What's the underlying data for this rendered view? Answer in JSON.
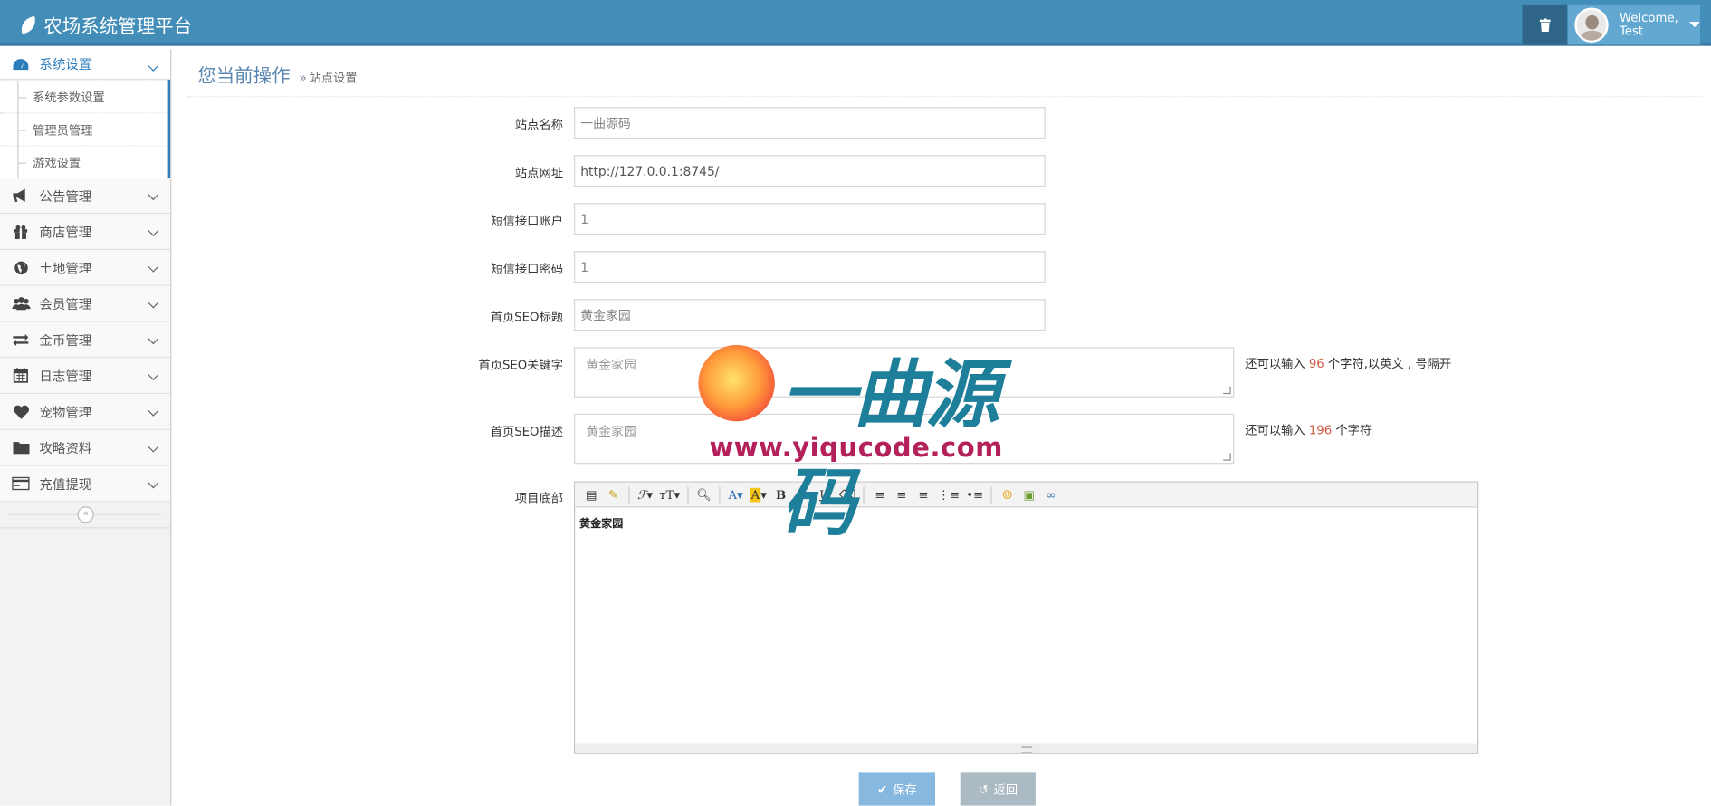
{
  "header": {
    "brand": "农场系统管理平台",
    "user_welcome": "Welcome,",
    "user_name": "Test"
  },
  "sidebar": {
    "items": [
      {
        "label": "系统设置",
        "icon": "dashboard-icon",
        "open": true,
        "children": [
          "系统参数设置",
          "管理员管理",
          "游戏设置"
        ]
      },
      {
        "label": "公告管理",
        "icon": "bullhorn-icon"
      },
      {
        "label": "商店管理",
        "icon": "gift-icon"
      },
      {
        "label": "土地管理",
        "icon": "globe-icon"
      },
      {
        "label": "会员管理",
        "icon": "users-icon"
      },
      {
        "label": "金币管理",
        "icon": "exchange-icon"
      },
      {
        "label": "日志管理",
        "icon": "calendar-icon"
      },
      {
        "label": "宠物管理",
        "icon": "heart-icon"
      },
      {
        "label": "攻略资料",
        "icon": "folder-icon"
      },
      {
        "label": "充值提现",
        "icon": "credit-card-icon"
      }
    ]
  },
  "breadcrumb": {
    "title": "您当前操作",
    "separator": "»",
    "current": "站点设置"
  },
  "form": {
    "site_name": {
      "label": "站点名称",
      "value": "一曲源码"
    },
    "site_url": {
      "label": "站点网址",
      "value": "http://127.0.0.1:8745/"
    },
    "sms_account": {
      "label": "短信接口账户",
      "value": "1"
    },
    "sms_password": {
      "label": "短信接口密码",
      "value": "1"
    },
    "seo_title": {
      "label": "首页SEO标题",
      "value": "黄金家园"
    },
    "seo_keywords": {
      "label": "首页SEO关键字",
      "value": "黄金家园",
      "hint_prefix": "还可以输入",
      "remaining": "96",
      "hint_suffix": "个字符,以英文 , 号隔开"
    },
    "seo_desc": {
      "label": "首页SEO描述",
      "value": "黄金家园",
      "hint_prefix": "还可以输入",
      "remaining": "196",
      "hint_suffix": "个字符"
    },
    "footer": {
      "label": "项目底部",
      "content": "黄金家园"
    }
  },
  "buttons": {
    "save": "保存",
    "back": "返回"
  },
  "watermark": {
    "title": "一曲源码",
    "url": "www.yiqucode.com"
  },
  "colors": {
    "navbar": "#438eb9",
    "accent": "#2b7dbc",
    "save_button": "#87b8e0",
    "back_button": "#abbac3",
    "hint_number": "#d15b47"
  }
}
